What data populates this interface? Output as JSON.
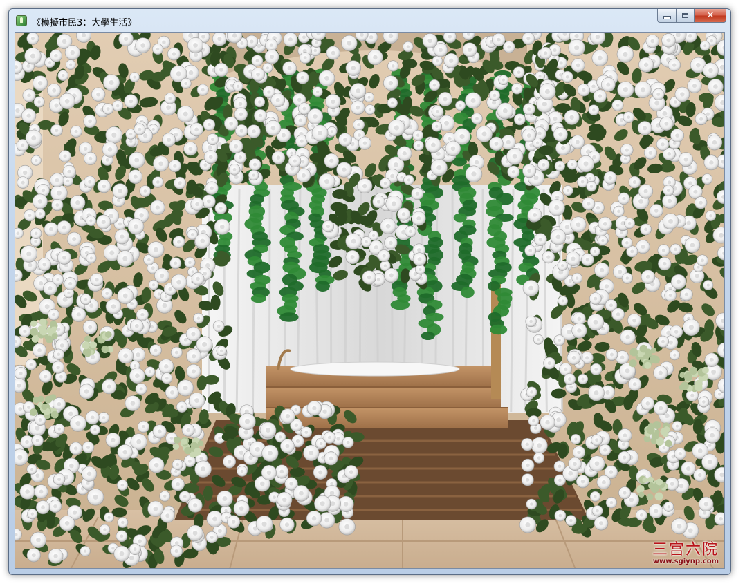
{
  "window": {
    "title": "《模擬市民3：大學生活》",
    "close_label": "✕"
  },
  "watermark": {
    "logo": "三宫六院",
    "url": "www.sgiynp.com"
  },
  "colors": {
    "titlebar": "#c4d6ec",
    "close_button": "#c0391f",
    "flower": "#f2f2f2",
    "leaf": "#3b5a2a",
    "deck": "#6b4a30",
    "steps": "#b98a5c"
  },
  "icons": {
    "app": "sims-plumbob-icon",
    "minimize": "minimize-icon",
    "maximize": "maximize-icon",
    "close": "close-icon"
  }
}
